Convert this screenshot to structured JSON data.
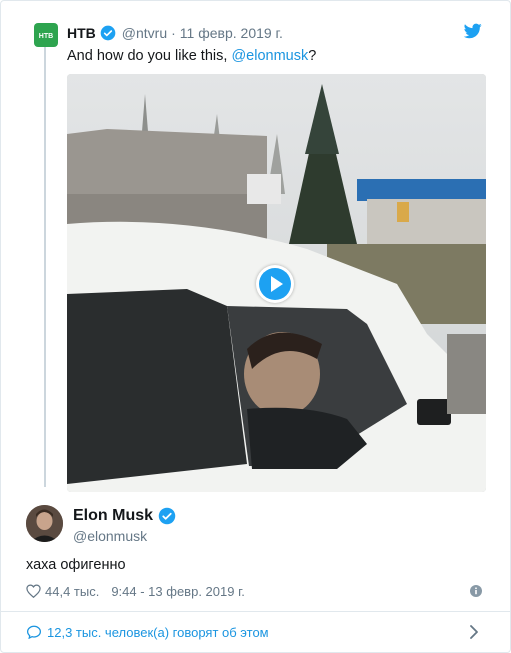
{
  "quoted": {
    "name": "НТВ",
    "handle": "@ntvru",
    "separator": "·",
    "date": "11 февр. 2019 г.",
    "text_before": "And how do you like this, ",
    "mention": "@elonmusk",
    "text_after": "?",
    "avatar_color": "#2ea44f"
  },
  "tweet": {
    "author_name": "Elon Musk",
    "author_handle": "@elonmusk",
    "text": "хаха офигенно",
    "likes": "44,4 тыс.",
    "timestamp": "9:44 - 13 февр. 2019 г."
  },
  "footer": {
    "conversation_label": "12,3 тыс. человек(а) говорят об этом"
  },
  "colors": {
    "verified": "#1da1f2",
    "link": "#1b95e0",
    "muted": "#657786"
  }
}
